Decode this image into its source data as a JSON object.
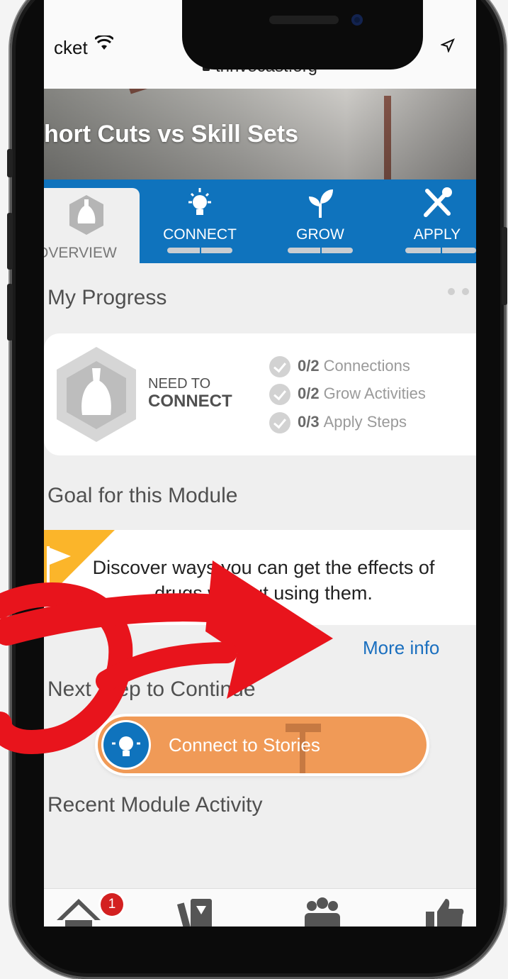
{
  "status": {
    "carrier": "cket"
  },
  "browser": {
    "url": "thrivecast.org"
  },
  "module": {
    "title": "hort Cuts vs Skill Sets"
  },
  "tabs": [
    {
      "label": "OVERVIEW",
      "icon": "badge-icon"
    },
    {
      "label": "CONNECT",
      "icon": "lightbulb-icon"
    },
    {
      "label": "GROW",
      "icon": "sprout-icon"
    },
    {
      "label": "APPLY",
      "icon": "tools-icon"
    }
  ],
  "progress": {
    "heading": "My Progress",
    "status_small": "NEED TO",
    "status_big": "CONNECT",
    "stats": [
      {
        "count": "0/2",
        "label": "Connections"
      },
      {
        "count": "0/2",
        "label": "Grow Activities"
      },
      {
        "count": "0/3",
        "label": "Apply Steps"
      }
    ]
  },
  "goal": {
    "heading": "Goal for this Module",
    "text": "Discover ways you can get the effects of drugs without using them.",
    "more_info": "More info"
  },
  "next_step": {
    "heading": "Next Step to Continue",
    "button_label": "Connect to Stories"
  },
  "recent": {
    "heading": "Recent Module Activity"
  },
  "bottom_nav": {
    "home_badge": "1",
    "items": [
      "home-icon",
      "cards-icon",
      "people-icon",
      "thumbs-up-icon"
    ]
  },
  "colors": {
    "tab_blue": "#0f73bd",
    "cta_orange": "#f09a57",
    "flag_yellow": "#fbb52a",
    "link_blue": "#1a6fbf",
    "annotation_red": "#e8141c"
  }
}
